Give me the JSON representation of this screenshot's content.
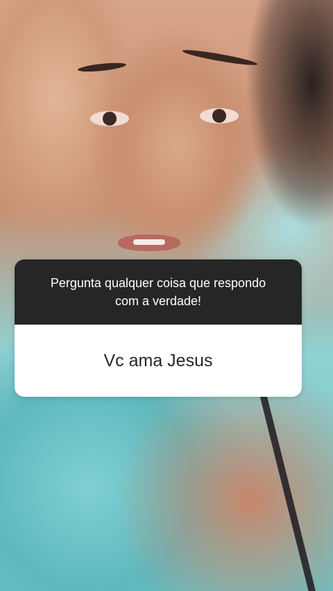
{
  "question_box": {
    "prompt": "Pergunta qualquer coisa que respondo com a verdade!",
    "answer": "Vc ama Jesus"
  },
  "colors": {
    "prompt_background": "#262626",
    "prompt_text": "#ffffff",
    "answer_background": "#ffffff",
    "answer_text": "#262626"
  }
}
